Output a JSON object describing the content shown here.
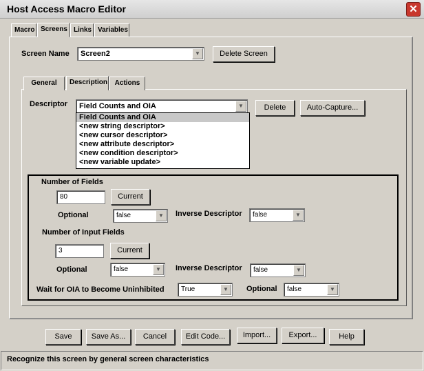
{
  "window": {
    "title": "Host Access Macro Editor",
    "close_glyph": "✕"
  },
  "top_tabs": [
    "Macro",
    "Screens",
    "Links",
    "Variables"
  ],
  "screen": {
    "name_label": "Screen Name",
    "name_value": "Screen2",
    "delete_label": "Delete Screen"
  },
  "sub_tabs": [
    "General",
    "Description",
    "Actions"
  ],
  "descriptor": {
    "label": "Descriptor",
    "value": "Field Counts and OIA",
    "delete_label": "Delete",
    "autocapture_label": "Auto-Capture...",
    "options": [
      "Field Counts and OIA",
      "<new string descriptor>",
      "<new cursor descriptor>",
      "<new attribute descriptor>",
      "<new condition descriptor>",
      "<new variable update>"
    ]
  },
  "fields": {
    "num_fields_label": "Number of Fields",
    "num_fields_value": "80",
    "current_label": "Current",
    "optional_label": "Optional",
    "optional1_value": "false",
    "inverse_label": "Inverse Descriptor",
    "inverse1_value": "false",
    "num_input_label": "Number of Input Fields",
    "num_input_value": "3",
    "optional2_value": "false",
    "inverse2_value": "false",
    "wait_label": "Wait for OIA to Become Uninhibited",
    "wait_value": "True",
    "optional3_value": "false"
  },
  "bottom_buttons": [
    "Save",
    "Save As...",
    "Cancel",
    "Edit Code...",
    "Import...",
    "Export...",
    "Help"
  ],
  "status": "Recognize this screen by general screen characteristics",
  "icons": {
    "dropdown_arrow": "▼"
  }
}
